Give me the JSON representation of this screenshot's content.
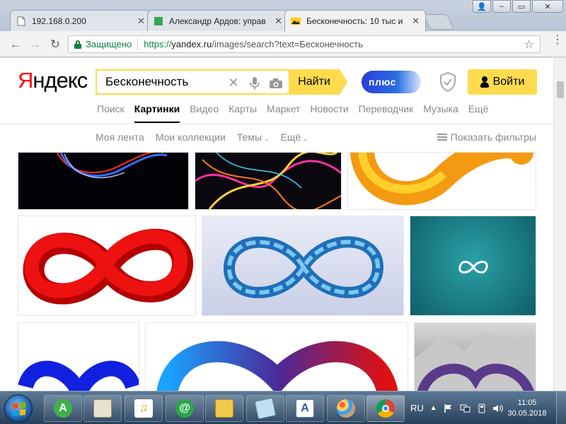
{
  "browser": {
    "tabs": [
      {
        "title": "192.168.0.200",
        "favicon": "document-icon",
        "active": false
      },
      {
        "title": "Александр Ардов: управ",
        "favicon": "green-square-icon",
        "active": false
      },
      {
        "title": "Бесконечность: 10 тыс и",
        "favicon": "yandex-images-icon",
        "active": true
      }
    ],
    "window_controls": {
      "user": "👤",
      "minimize": "‒",
      "maximize": "▭",
      "close": "✕"
    },
    "back": "←",
    "forward": "→",
    "reload": "↻",
    "secure_label": "Защищено",
    "url_scheme": "https://",
    "url_host": "yandex.ru",
    "url_path": "/images/search?text=Бесконечность",
    "star": "☆",
    "menu": "⋮"
  },
  "yandex": {
    "logo_first": "Я",
    "logo_rest": "ндекс",
    "search_query": "Бесконечность",
    "clear": "✕",
    "find_label": "Найти",
    "plus_label": "плюс",
    "login_label": "Войти",
    "services": [
      {
        "label": "Поиск",
        "active": false
      },
      {
        "label": "Картинки",
        "active": true
      },
      {
        "label": "Видео",
        "active": false
      },
      {
        "label": "Карты",
        "active": false
      },
      {
        "label": "Маркет",
        "active": false
      },
      {
        "label": "Новости",
        "active": false
      },
      {
        "label": "Переводчик",
        "active": false
      },
      {
        "label": "Музыка",
        "active": false
      },
      {
        "label": "Ещё",
        "active": false
      }
    ],
    "subnav": {
      "feed": "Моя лента",
      "collections": "Мои коллекции",
      "themes": "Темы",
      "more": "Ещё",
      "caret": "⌄",
      "show_filters": "Показать фильтры"
    }
  },
  "taskbar": {
    "language": "RU",
    "time": "11:05",
    "date": "30.05.2018",
    "tray_arrow": "▲"
  },
  "colors": {
    "yandex_yellow": "#ffdb4d",
    "yandex_red": "#ff0000",
    "secure_green": "#0b8043"
  }
}
